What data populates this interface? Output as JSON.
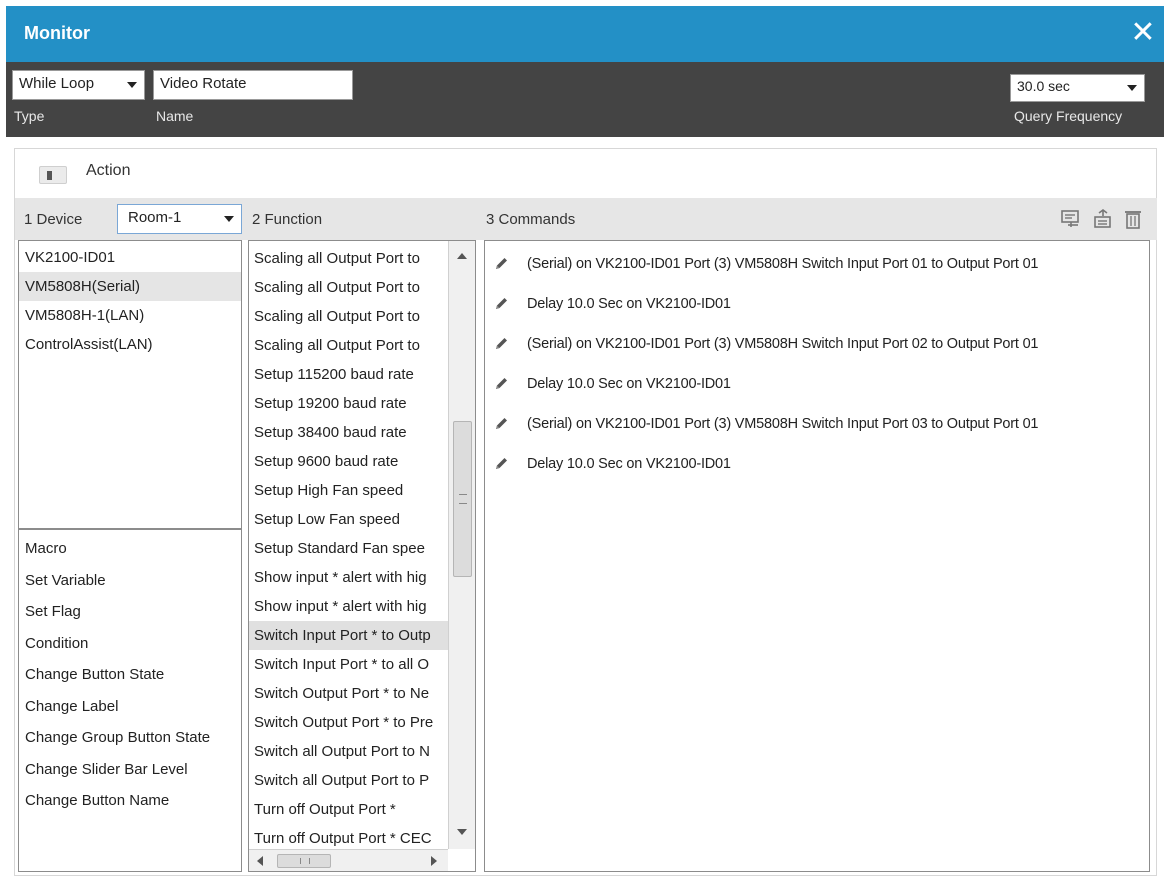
{
  "window": {
    "title": "Monitor",
    "accent": "#2390c6"
  },
  "topbar": {
    "type_value": "While Loop",
    "type_label": "Type",
    "name_value": "Video Rotate",
    "name_label": "Name",
    "frequency_value": "30.0 sec",
    "frequency_label": "Query Frequency"
  },
  "action": {
    "label": "Action"
  },
  "columns": {
    "device_header": "1  Device",
    "device_filter": "Room-1",
    "function_header": "2  Function",
    "commands_header": "3  Commands"
  },
  "toolbar_icons": [
    "monitor-add-icon",
    "import-icon",
    "trash-icon"
  ],
  "devices": [
    {
      "label": "VK2100-ID01",
      "selected": false
    },
    {
      "label": "VM5808H(Serial)",
      "selected": true
    },
    {
      "label": "VM5808H-1(LAN)",
      "selected": false
    },
    {
      "label": "ControlAssist(LAN)",
      "selected": false
    }
  ],
  "logic_items": [
    "Macro",
    "Set Variable",
    "Set Flag",
    "Condition",
    "Change Button State",
    "Change Label",
    "Change Group Button State",
    "Change Slider Bar Level",
    "Change Button Name"
  ],
  "functions": [
    {
      "label": "Scaling all Output Port to",
      "selected": false
    },
    {
      "label": "Scaling all Output Port to",
      "selected": false
    },
    {
      "label": "Scaling all Output Port to",
      "selected": false
    },
    {
      "label": "Scaling all Output Port to",
      "selected": false
    },
    {
      "label": "Setup 115200 baud rate",
      "selected": false
    },
    {
      "label": "Setup 19200 baud rate",
      "selected": false
    },
    {
      "label": "Setup 38400 baud rate",
      "selected": false
    },
    {
      "label": "Setup 9600 baud rate",
      "selected": false
    },
    {
      "label": "Setup High Fan speed",
      "selected": false
    },
    {
      "label": "Setup Low Fan speed",
      "selected": false
    },
    {
      "label": "Setup Standard Fan spee",
      "selected": false
    },
    {
      "label": "Show input * alert with hig",
      "selected": false
    },
    {
      "label": "Show input * alert with hig",
      "selected": false
    },
    {
      "label": "Switch Input Port * to Outp",
      "selected": true
    },
    {
      "label": "Switch Input Port * to all O",
      "selected": false
    },
    {
      "label": "Switch Output Port * to Ne",
      "selected": false
    },
    {
      "label": "Switch Output Port * to Pre",
      "selected": false
    },
    {
      "label": "Switch all Output Port to N",
      "selected": false
    },
    {
      "label": "Switch all Output Port to P",
      "selected": false
    },
    {
      "label": "Turn off Output Port *",
      "selected": false
    },
    {
      "label": "Turn off Output Port * CEC",
      "selected": false
    }
  ],
  "commands": [
    "(Serial) on VK2100-ID01 Port (3) VM5808H Switch Input Port 01 to Output Port 01",
    "Delay 10.0 Sec on VK2100-ID01",
    "(Serial) on VK2100-ID01 Port (3) VM5808H Switch Input Port 02 to Output Port 01",
    "Delay 10.0 Sec on VK2100-ID01",
    "(Serial) on VK2100-ID01 Port (3) VM5808H Switch Input Port 03 to Output Port 01",
    "Delay 10.0 Sec on VK2100-ID01"
  ]
}
